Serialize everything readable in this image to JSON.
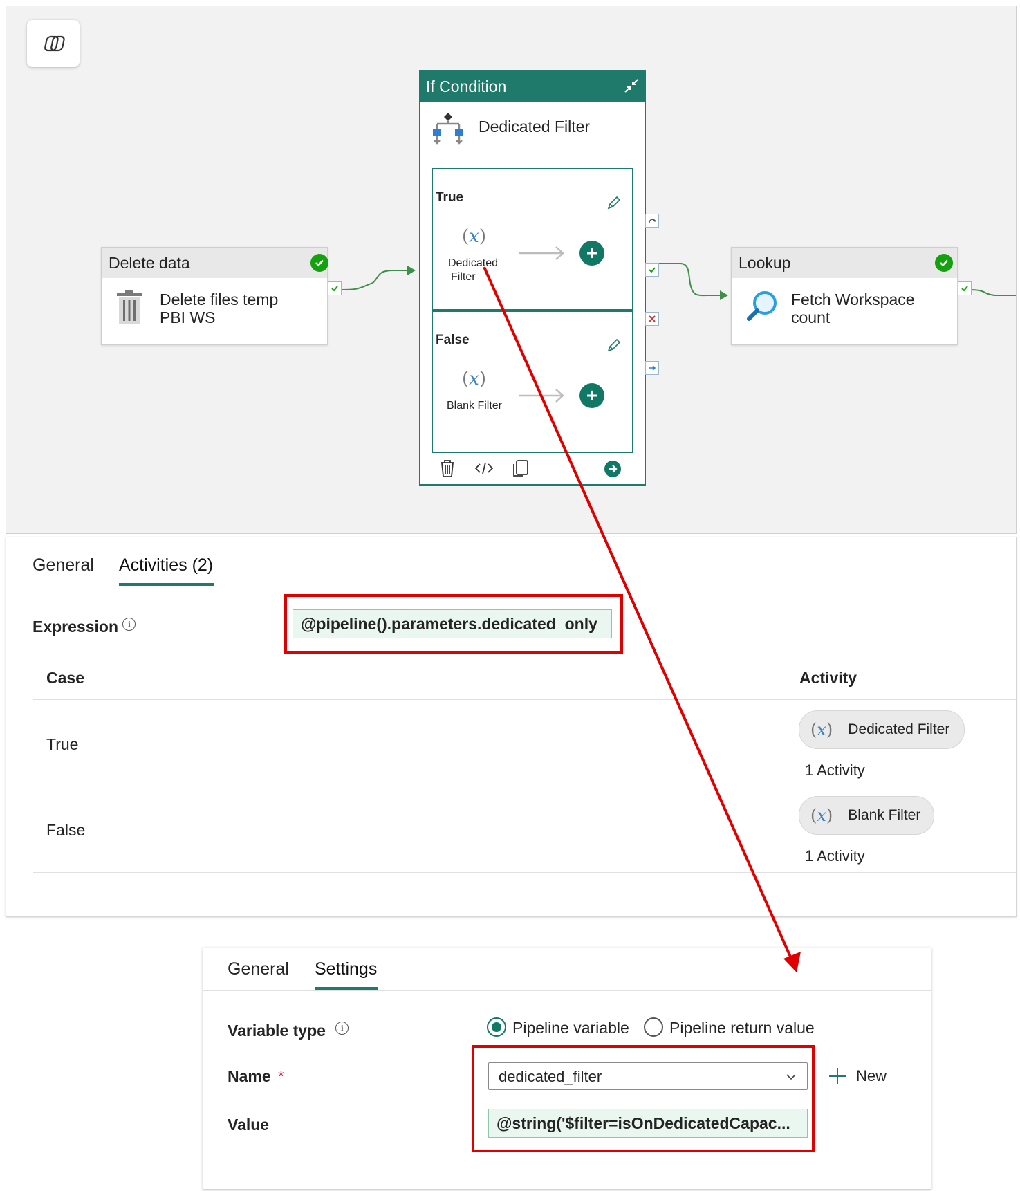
{
  "canvas": {
    "delete_node": {
      "type": "Delete data",
      "name_line1": "Delete files temp",
      "name_line2": "PBI WS"
    },
    "lookup_node": {
      "type": "Lookup",
      "name_line1": "Fetch Workspace",
      "name_line2": "count"
    },
    "if_node": {
      "type": "If Condition",
      "name": "Dedicated Filter",
      "true_label": "True",
      "true_activity_line1": "Dedicated",
      "true_activity_line2": "Filter",
      "false_label": "False",
      "false_activity": "Blank Filter"
    }
  },
  "activities_panel": {
    "tabs": [
      "General",
      "Activities (2)"
    ],
    "active_tab": "Activities (2)",
    "expression_label": "Expression",
    "expression_value": "@pipeline().parameters.dedicated_only",
    "col_case": "Case",
    "col_activity": "Activity",
    "rows": [
      {
        "case": "True",
        "activity": "Dedicated Filter",
        "count": "1 Activity"
      },
      {
        "case": "False",
        "activity": "Blank Filter",
        "count": "1 Activity"
      }
    ]
  },
  "settings_panel": {
    "tabs": [
      "General",
      "Settings"
    ],
    "active_tab": "Settings",
    "variable_type_label": "Variable type",
    "radio_pipeline_variable": "Pipeline variable",
    "radio_pipeline_return": "Pipeline return value",
    "selected_radio": "Pipeline variable",
    "name_label": "Name",
    "required_mark": "*",
    "name_value": "dedicated_filter",
    "new_label": "New",
    "value_label": "Value",
    "value_value": "@string('$filter=isOnDedicatedCapac..."
  },
  "colors": {
    "accent_teal": "#1f7a6b",
    "success_green": "#13a10e",
    "annotation_red": "#e00000",
    "canvas_bg": "#f2f2f2"
  },
  "icons": [
    "copilot-icon",
    "check-icon",
    "trash-icon",
    "magnifier-icon",
    "if-condition-icon",
    "variable-icon",
    "pencil-icon",
    "plus-icon",
    "code-icon",
    "copy-icon",
    "arrow-right-icon",
    "collapse-icon",
    "info-icon",
    "chevron-down-icon",
    "skip-icon",
    "fail-icon",
    "completion-icon"
  ]
}
